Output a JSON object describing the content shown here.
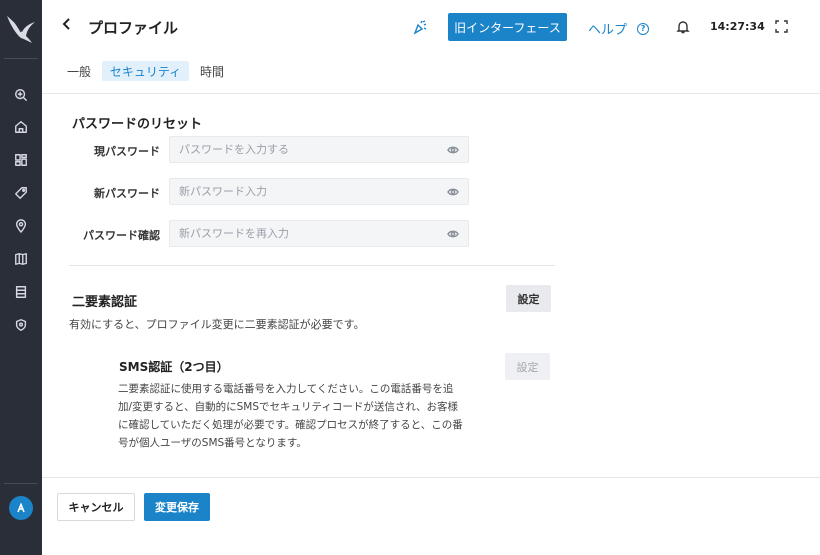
{
  "header": {
    "title": "プロファイル",
    "legacy_button": "旧インターフェース",
    "help_label": "ヘルプ",
    "help_icon_glyph": "?",
    "time": "14:27:34"
  },
  "tabs": [
    {
      "label": "一般",
      "active": false
    },
    {
      "label": "セキュリティ",
      "active": true
    },
    {
      "label": "時間",
      "active": false
    }
  ],
  "password_reset": {
    "title": "パスワードのリセット",
    "fields": [
      {
        "label": "現パスワード",
        "placeholder": "パスワードを入力する",
        "value": ""
      },
      {
        "label": "新パスワード",
        "placeholder": "新パスワード入力",
        "value": ""
      },
      {
        "label": "パスワード確認",
        "placeholder": "新パスワードを再入力",
        "value": ""
      }
    ]
  },
  "two_factor": {
    "title": "二要素認証",
    "settings_button": "設定",
    "description": "有効にすると、プロファイル変更に二要素認証が必要です。",
    "sms": {
      "title": "SMS認証（2つ目）",
      "settings_button": "設定",
      "description": "二要素認証に使用する電話番号を入力してください。この電話番号を追加/変更すると、自動的にSMSでセキュリティコードが送信され、お客様に確認していただく処理が必要です。確認プロセスが終了すると、この番号が個人ユーザのSMS番号となります。"
    }
  },
  "footer": {
    "cancel": "キャンセル",
    "save": "変更保存"
  },
  "sidebar": {
    "icons": [
      "logo-bird",
      "zoom-in-icon",
      "home-icon",
      "dashboard-icon",
      "tag-icon",
      "location-pin-icon",
      "map-icon",
      "server-icon",
      "shield-icon",
      "user-avatar-icon"
    ]
  },
  "colors": {
    "accent": "#1b84c9",
    "sidebar_bg": "#2a2e38",
    "tab_active_bg": "#e1f0fb"
  }
}
